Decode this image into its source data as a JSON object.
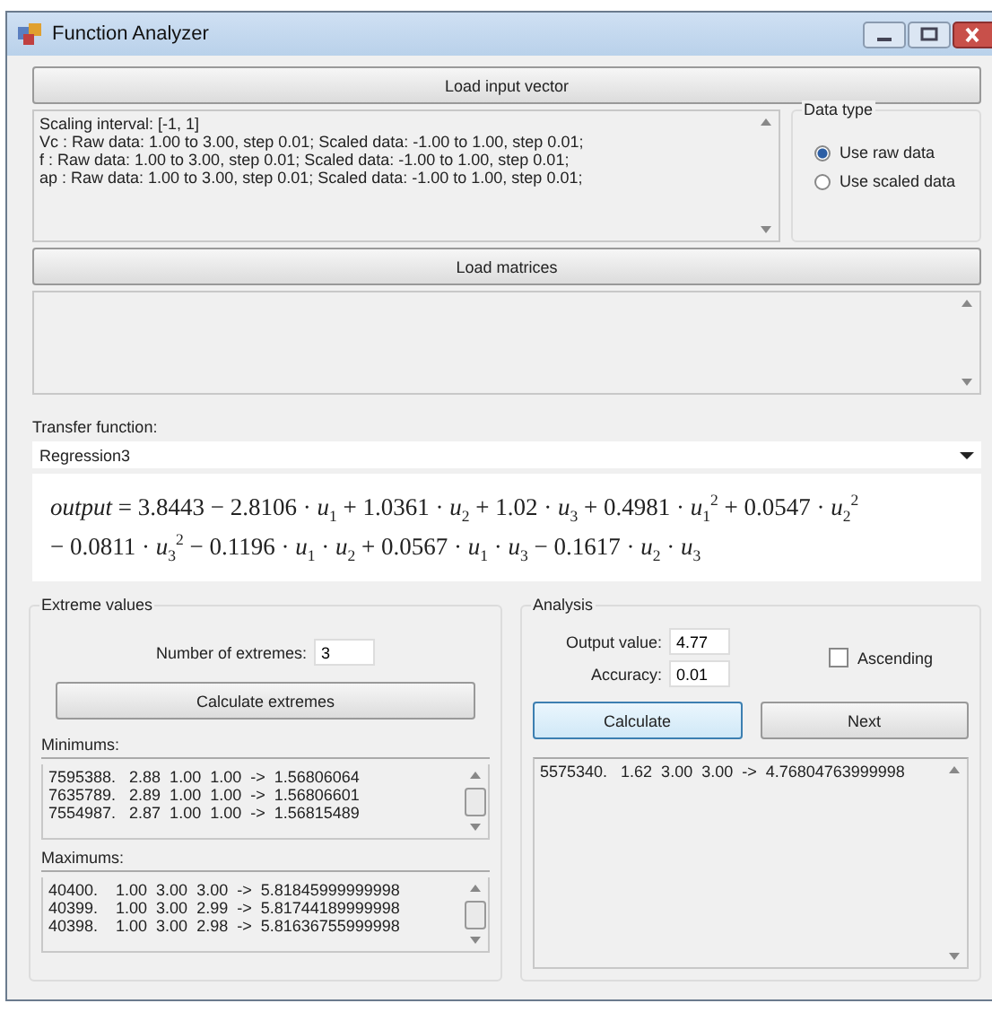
{
  "window": {
    "title": "Function Analyzer"
  },
  "load_input_button": "Load input vector",
  "info_lines": [
    "Scaling interval: [-1, 1]",
    "Vc : Raw data: 1.00 to 3.00, step 0.01; Scaled data: -1.00 to 1.00, step 0.01;",
    "f : Raw data: 1.00 to 3.00, step 0.01; Scaled data: -1.00 to 1.00, step 0.01;",
    "ap : Raw data: 1.00 to 3.00, step 0.01; Scaled data: -1.00 to 1.00, step 0.01;"
  ],
  "data_type": {
    "title": "Data type",
    "options": [
      {
        "label": "Use raw data",
        "selected": true
      },
      {
        "label": "Use scaled data",
        "selected": false
      }
    ]
  },
  "load_matrices_button": "Load matrices",
  "transfer_function": {
    "label": "Transfer function:",
    "value": "Regression3"
  },
  "formula_lines": [
    "*output* = 3.8443 − 2.8106 · *u*$_{1}$ + 1.0361 · *u*$_{2}$ + 1.02 · *u*$_{3}$ + 0.4981 · *u*$_{1}$$^{2}$ + 0.0547 · *u*$_{2}$$^{2}$",
    "− 0.0811 · *u*$_{3}$$^{2}$ − 0.1196 · *u*$_{1}$ · *u*$_{2}$ + 0.0567 · *u*$_{1}$ · *u*$_{3}$ − 0.1617 · *u*$_{2}$ · *u*$_{3}$"
  ],
  "extreme_values": {
    "title": "Extreme values",
    "count_label": "Number of extremes:",
    "count_value": "3",
    "button": "Calculate extremes",
    "minimums_label": "Minimums:",
    "minimums": [
      "7595388.   2.88  1.00  1.00  ->  1.56806064",
      "7635789.   2.89  1.00  1.00  ->  1.56806601",
      "7554987.   2.87  1.00  1.00  ->  1.56815489"
    ],
    "maximums_label": "Maximums:",
    "maximums": [
      "40400.    1.00  3.00  3.00  ->  5.81845999999998",
      "40399.    1.00  3.00  2.99  ->  5.81744189999998",
      "40398.    1.00  3.00  2.98  ->  5.81636755999998"
    ]
  },
  "analysis": {
    "title": "Analysis",
    "output_label": "Output value:",
    "output_value": "4.77",
    "accuracy_label": "Accuracy:",
    "accuracy_value": "0.01",
    "ascending": {
      "label": "Ascending",
      "checked": false
    },
    "calculate_button": "Calculate",
    "next_button": "Next",
    "results": [
      "5575340.   1.62  3.00  3.00  ->  4.76804763999998"
    ]
  }
}
